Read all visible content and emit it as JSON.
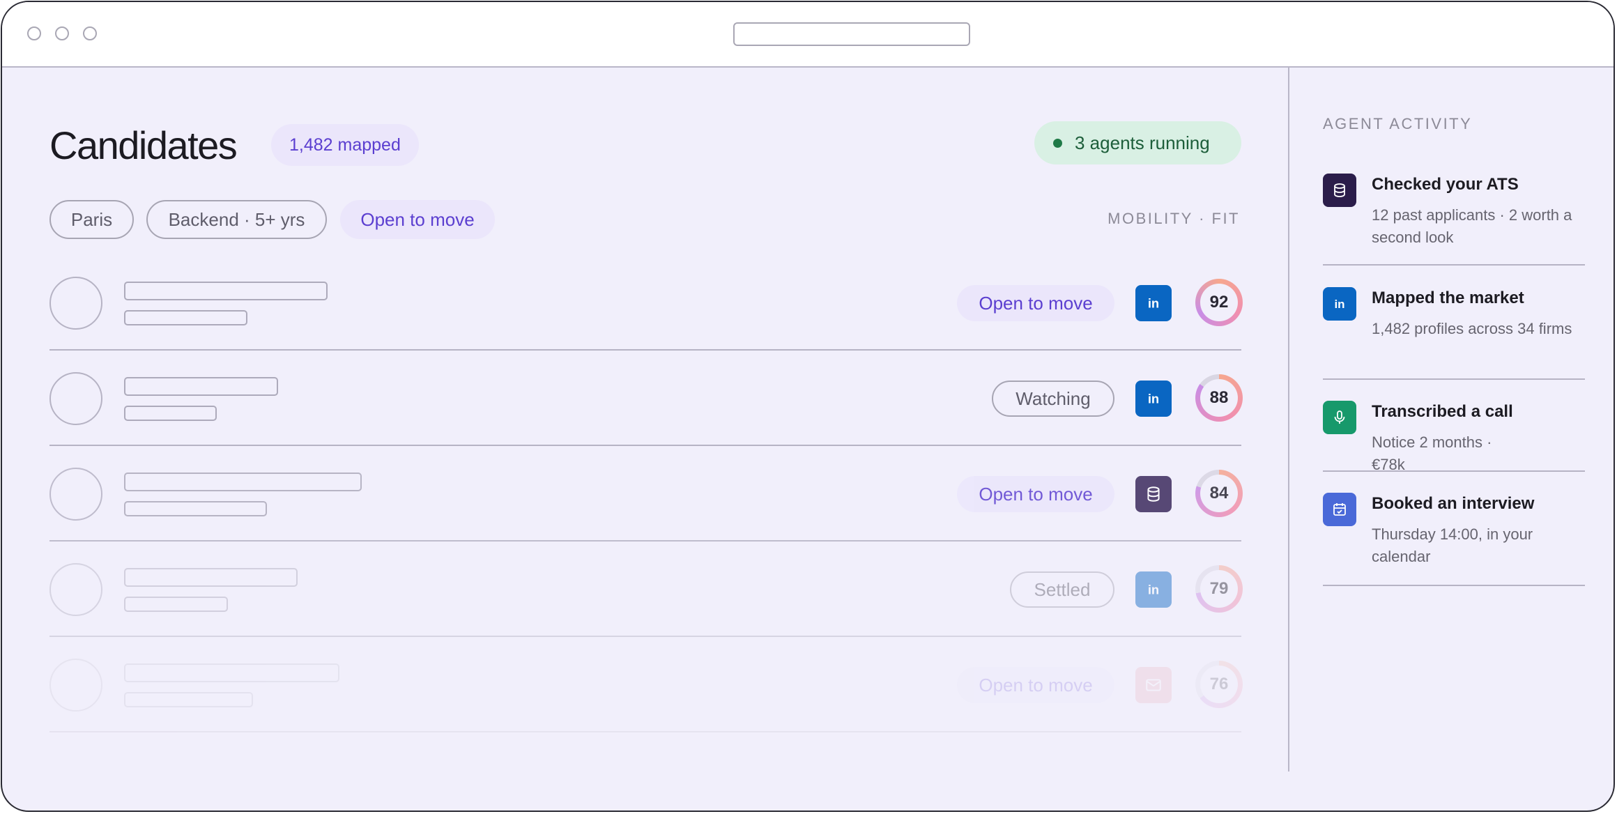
{
  "header": {
    "title": "Candidates",
    "mapped_badge": "1,482 mapped",
    "agents_badge": "3 agents running"
  },
  "filters": [
    "Paris",
    "Backend · 5+ yrs",
    "Open to move"
  ],
  "column_label": "MOBILITY · FIT",
  "rows": [
    {
      "status": "Open to move",
      "source_icon": "linkedin-icon",
      "score": "92"
    },
    {
      "status": "Watching",
      "source_icon": "linkedin-icon",
      "score": "88"
    },
    {
      "status": "Open to move",
      "source_icon": "database-icon",
      "score": "84"
    },
    {
      "status": "Settled",
      "source_icon": "linkedin-icon",
      "score": "79"
    },
    {
      "status": "Open to move",
      "source_icon": "mail-icon",
      "score": "76"
    }
  ],
  "sidebar": {
    "title": "AGENT ACTIVITY",
    "items": [
      {
        "title": "Checked your ATS",
        "desc": "12 past applicants · 2 worth a second look",
        "icon": "database-icon"
      },
      {
        "title": "Mapped the market",
        "desc": "1,482 profiles across 34 firms",
        "icon": "linkedin-icon"
      },
      {
        "title": "Transcribed a call",
        "desc": "Notice 2 months · €78k",
        "icon": "microphone-icon"
      },
      {
        "title": "Booked an interview",
        "desc": "Thursday 14:00, in your calendar",
        "icon": "calendar-icon"
      }
    ]
  },
  "colors": {
    "accent": "#5b3fd0",
    "linkedin": "#0a66c2",
    "ats": "#2b1d4a",
    "success": "#1f7a47",
    "transcribe": "#17996b",
    "calendar": "#4a69d8",
    "mail": "#e99aa6"
  }
}
